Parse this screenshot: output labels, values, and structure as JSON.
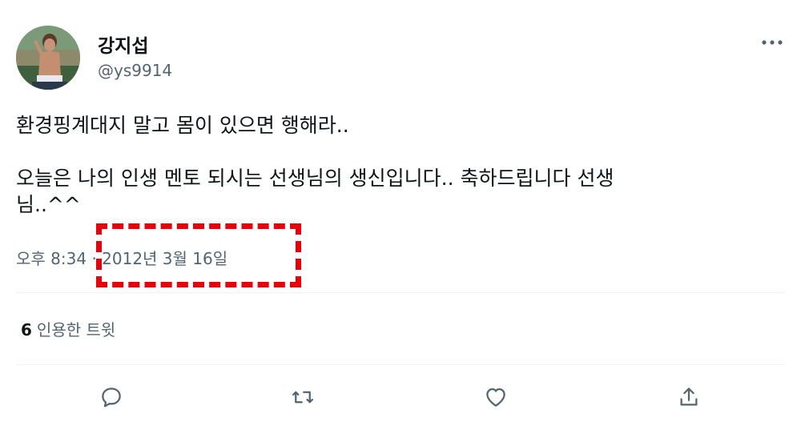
{
  "author": {
    "display_name": "강지섭",
    "handle": "@ys9914"
  },
  "tweet": {
    "text": "환경핑계대지 말고 몸이 있으면 행해라..\n\n오늘은 나의 인생 멘토 되시는 선생님의 생신입니다.. 축하드립니다 선생\n님..^^",
    "time": "오후 8:34",
    "separator": "·",
    "date": "2012년 3월 16일"
  },
  "stats": {
    "quote_count": "6",
    "quote_label": "인용한 트윗"
  },
  "icons": {
    "more": "more-icon",
    "reply": "reply-icon",
    "retweet": "retweet-icon",
    "like": "like-icon",
    "share": "share-icon"
  },
  "colors": {
    "text_primary": "#0f1419",
    "text_secondary": "#536471",
    "divider": "#eff3f4",
    "highlight": "#e8000b"
  }
}
